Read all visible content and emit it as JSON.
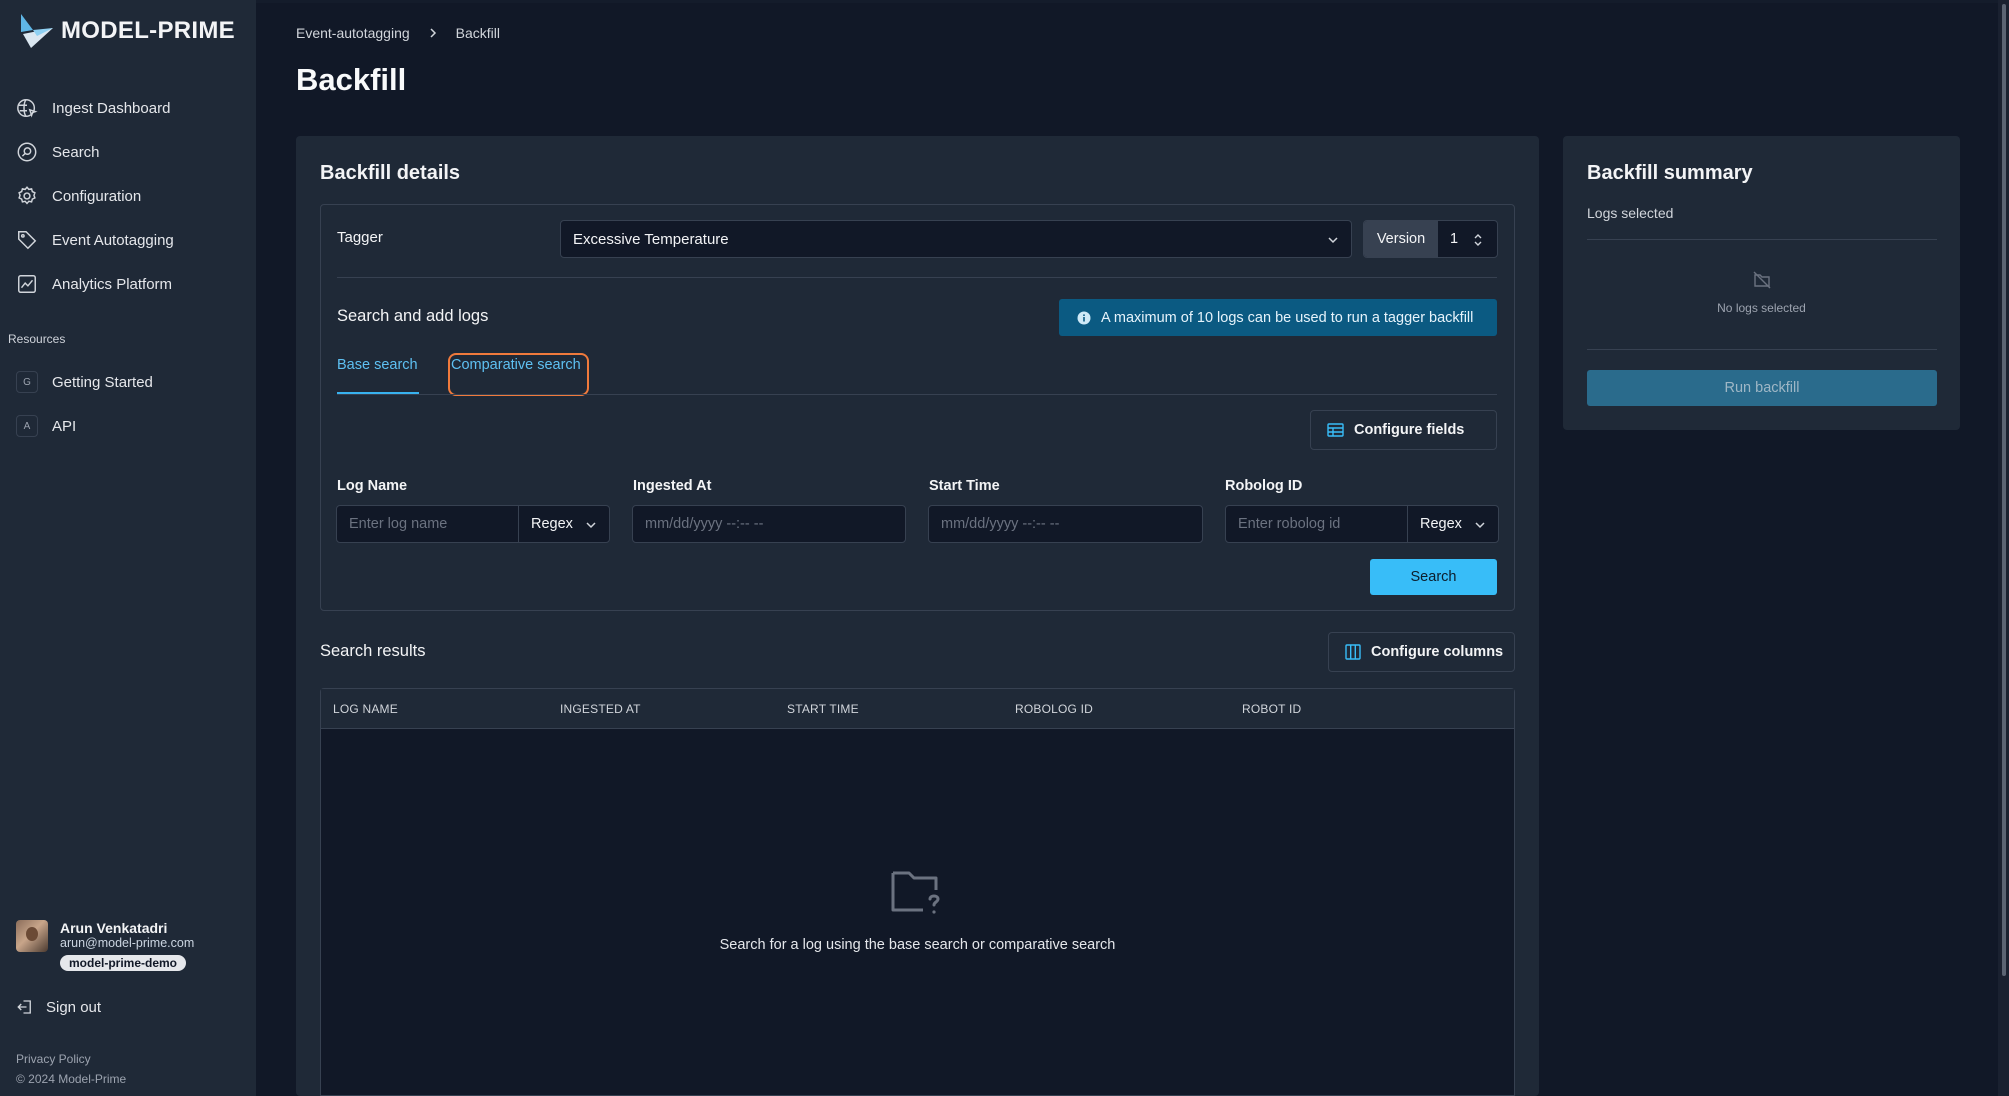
{
  "app": {
    "brand": "MODEL-PRIME"
  },
  "sidebar": {
    "nav": [
      {
        "label": "Ingest Dashboard",
        "icon": "globe-icon"
      },
      {
        "label": "Search",
        "icon": "search-icon"
      },
      {
        "label": "Configuration",
        "icon": "gear-icon"
      },
      {
        "label": "Event Autotagging",
        "icon": "tag-icon"
      },
      {
        "label": "Analytics Platform",
        "icon": "chart-icon"
      }
    ],
    "resources_label": "Resources",
    "resources": [
      {
        "badge": "G",
        "label": "Getting Started"
      },
      {
        "badge": "A",
        "label": "API"
      }
    ],
    "user": {
      "name": "Arun Venkatadri",
      "email": "arun@model-prime.com",
      "org": "model-prime-demo"
    },
    "signout": "Sign out",
    "privacy": "Privacy Policy",
    "copyright": "© 2024 Model-Prime"
  },
  "breadcrumb": {
    "parent": "Event-autotagging",
    "current": "Backfill"
  },
  "page_title": "Backfill",
  "details": {
    "title": "Backfill details",
    "tagger_label": "Tagger",
    "tagger_value": "Excessive Temperature",
    "version_label": "Version",
    "version_value": "1",
    "search_heading": "Search and add logs",
    "info": "A maximum of 10 logs can be used to run a tagger backfill",
    "tabs": {
      "base": "Base search",
      "comparative": "Comparative search"
    },
    "configure_fields": "Configure fields",
    "fields": {
      "log_name": {
        "label": "Log Name",
        "placeholder": "Enter log name",
        "mode": "Regex"
      },
      "ingested_at": {
        "label": "Ingested At",
        "placeholder": "mm/dd/yyyy --:-- --"
      },
      "start_time": {
        "label": "Start Time",
        "placeholder": "mm/dd/yyyy --:-- --"
      },
      "robolog_id": {
        "label": "Robolog ID",
        "placeholder": "Enter robolog id",
        "mode": "Regex"
      }
    },
    "search_button": "Search"
  },
  "results": {
    "title": "Search results",
    "configure_columns": "Configure columns",
    "columns": [
      "LOG NAME",
      "INGESTED AT",
      "START TIME",
      "ROBOLOG ID",
      "ROBOT ID"
    ],
    "empty": "Search for a log using the base search or comparative search"
  },
  "summary": {
    "title": "Backfill summary",
    "subtitle": "Logs selected",
    "empty": "No logs selected",
    "run_button": "Run backfill"
  },
  "colors": {
    "accent": "#38bdf8",
    "highlight": "#f07a3c",
    "info_bg": "#0b5a82"
  }
}
